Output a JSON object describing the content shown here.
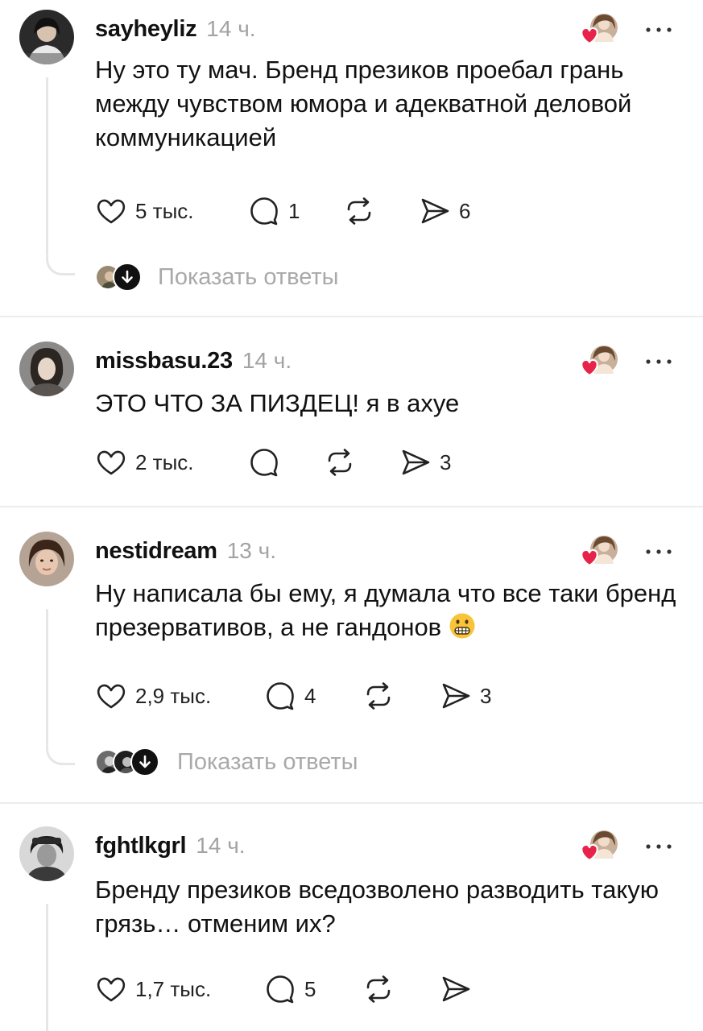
{
  "comments": [
    {
      "username": "sayheyliz",
      "time": "14 ч.",
      "text": "Ну это ту мач. Бренд презиков проебал грань между чувством юмора и адекватной деловой коммуникацией",
      "likes": "5 тыс.",
      "replies_count": "1",
      "shares": "6",
      "show_replies": "Показать ответы"
    },
    {
      "username": "missbasu.23",
      "time": "14 ч.",
      "text": "ЭТО ЧТО ЗА ПИЗДЕЦ! я в ахуе",
      "likes": "2 тыс.",
      "replies_count": "",
      "shares": "3"
    },
    {
      "username": "nestidream",
      "time": "13 ч.",
      "text": "Ну написала бы ему, я думала что все таки бренд презервативов, а не гандонов",
      "emoji": "grimacing-face",
      "likes": "2,9 тыс.",
      "replies_count": "4",
      "shares": "3",
      "show_replies": "Показать ответы"
    },
    {
      "username": "fghtlkgrl",
      "time": "14 ч.",
      "text": "Бренду презиков вседозволено разводить такую грязь… отменим их?",
      "likes": "1,7 тыс.",
      "replies_count": "5",
      "shares": ""
    }
  ],
  "icons": {
    "like": "heart-outline-icon",
    "reply": "speech-bubble-icon",
    "repost": "repost-arrows-icon",
    "share": "send-arrow-icon",
    "creator_like": "creator-liked-heart-icon",
    "more": "more-dots-icon",
    "expand": "arrow-down-icon"
  },
  "colors": {
    "text": "#111111",
    "muted": "#a3a3a3",
    "creator_heart": "#e8234a",
    "divider": "#ececec"
  }
}
